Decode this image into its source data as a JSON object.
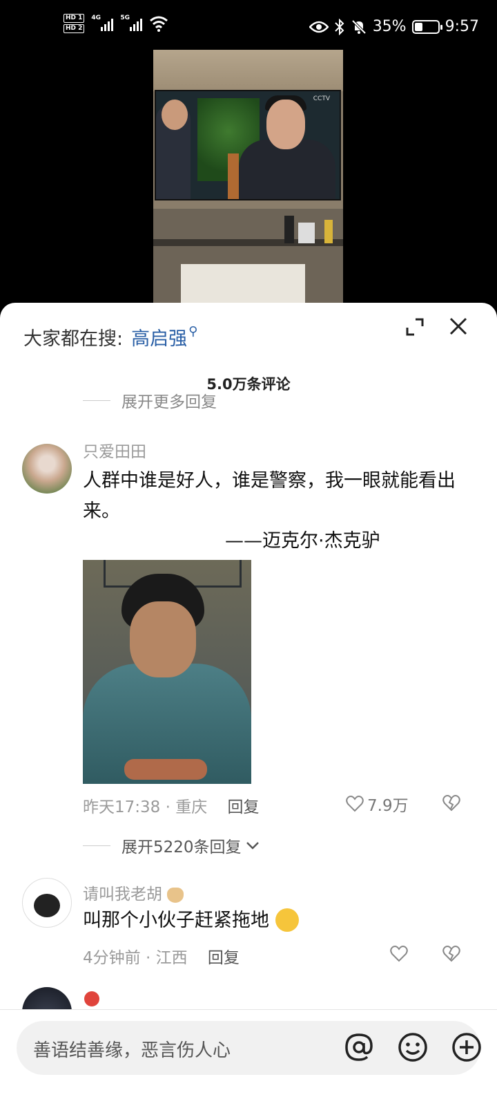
{
  "status": {
    "sim1": "HD 1",
    "sim2": "HD 2",
    "net1": "4G",
    "net2": "5G",
    "battery_pct": "35%",
    "battery_level": 0.35,
    "time": "9:57"
  },
  "sheet": {
    "search_label": "大家都在搜:",
    "search_keyword": "高启强",
    "comment_count": "5.0万条评论",
    "expand_more_top": "展开更多回复"
  },
  "comments": [
    {
      "user": "只爱田田",
      "text": "人群中谁是好人，谁是警察，我一眼就能看出来。",
      "attribution": "——迈克尔·杰克驴",
      "time": "昨天17:38",
      "location": "重庆",
      "reply": "回复",
      "likes": "7.9万",
      "expand_replies": "展开5220条回复"
    },
    {
      "user": "请叫我老胡",
      "text": "叫那个小伙子赶紧拖地",
      "time": "4分钟前",
      "location": "江西",
      "reply": "回复"
    }
  ],
  "input": {
    "placeholder": "善语结善缘，恶言伤人心"
  },
  "colors": {
    "keyword": "#2a5fa6",
    "sheet_bg": "#ffffff",
    "input_bg": "#f1f1f1"
  }
}
